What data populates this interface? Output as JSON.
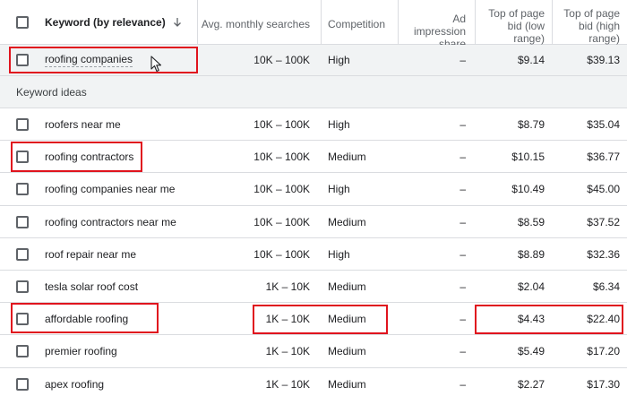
{
  "header": {
    "keyword_col": "Keyword (by relevance)",
    "avg_col": "Avg. monthly searches",
    "competition_col": "Competition",
    "impression_col_line1": "Ad impression",
    "impression_col_line2": "share",
    "low_bid_line1": "Top of page",
    "low_bid_line2": "bid (low",
    "low_bid_line3": "range)",
    "high_bid_line1": "Top of page",
    "high_bid_line2": "bid (high",
    "high_bid_line3": "range)"
  },
  "section_label": "Keyword ideas",
  "rows": [
    {
      "keyword": "roofing companies",
      "avg": "10K – 100K",
      "competition": "High",
      "impression": "–",
      "low": "$9.14",
      "high": "$39.13"
    },
    {
      "keyword": "roofers near me",
      "avg": "10K – 100K",
      "competition": "High",
      "impression": "–",
      "low": "$8.79",
      "high": "$35.04"
    },
    {
      "keyword": "roofing contractors",
      "avg": "10K – 100K",
      "competition": "Medium",
      "impression": "–",
      "low": "$10.15",
      "high": "$36.77"
    },
    {
      "keyword": "roofing companies near me",
      "avg": "10K – 100K",
      "competition": "High",
      "impression": "–",
      "low": "$10.49",
      "high": "$45.00"
    },
    {
      "keyword": "roofing contractors near me",
      "avg": "10K – 100K",
      "competition": "Medium",
      "impression": "–",
      "low": "$8.59",
      "high": "$37.52"
    },
    {
      "keyword": "roof repair near me",
      "avg": "10K – 100K",
      "competition": "High",
      "impression": "–",
      "low": "$8.89",
      "high": "$32.36"
    },
    {
      "keyword": "tesla solar roof cost",
      "avg": "1K – 10K",
      "competition": "Medium",
      "impression": "–",
      "low": "$2.04",
      "high": "$6.34"
    },
    {
      "keyword": "affordable roofing",
      "avg": "1K – 10K",
      "competition": "Medium",
      "impression": "–",
      "low": "$4.43",
      "high": "$22.40"
    },
    {
      "keyword": "premier roofing",
      "avg": "1K – 10K",
      "competition": "Medium",
      "impression": "–",
      "low": "$5.49",
      "high": "$17.20"
    },
    {
      "keyword": "apex roofing",
      "avg": "1K – 10K",
      "competition": "Medium",
      "impression": "–",
      "low": "$2.27",
      "high": "$17.30"
    }
  ],
  "colors": {
    "highlight": "#e0141e",
    "border": "#dadce0",
    "row_gray": "#f1f3f4"
  }
}
